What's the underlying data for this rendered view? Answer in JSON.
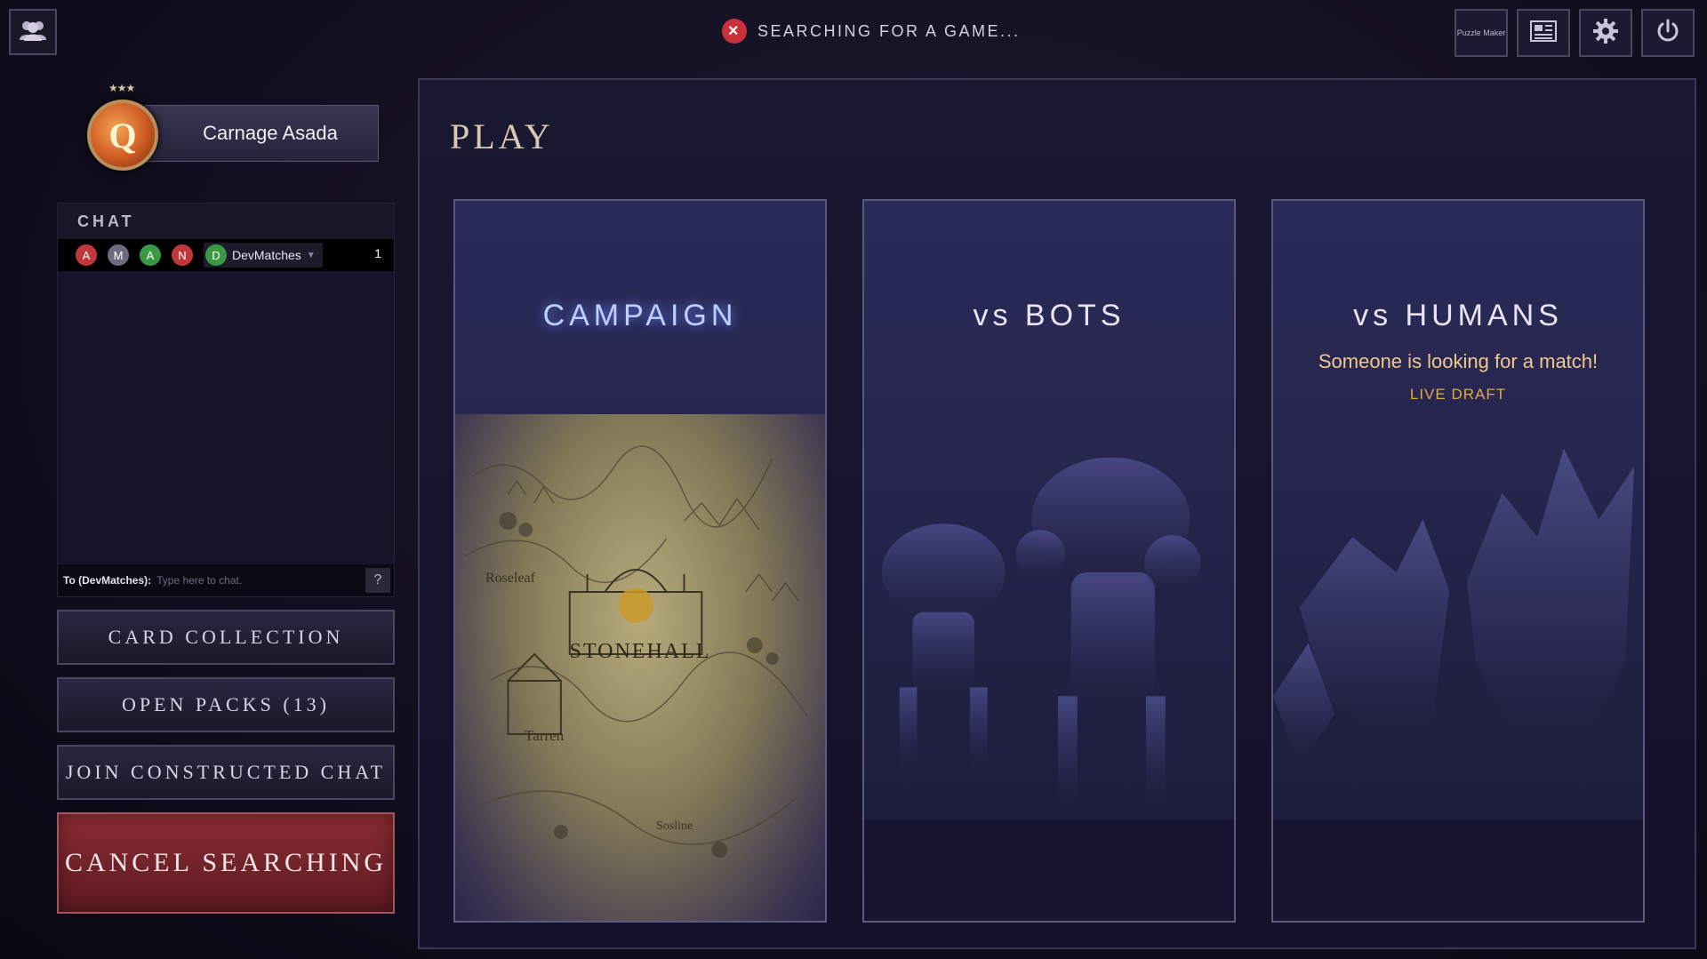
{
  "header": {
    "status_text": "SEARCHING FOR A GAME...",
    "puzzle_maker_label": "Puzzle Maker"
  },
  "player": {
    "name": "Carnage Asada",
    "avatar_letter": "Q",
    "stars": "★★★"
  },
  "chat": {
    "title": "CHAT",
    "channels": [
      {
        "letter": "A",
        "color": "#c0383c"
      },
      {
        "letter": "M",
        "color": "#6e6a80"
      },
      {
        "letter": "A",
        "color": "#3a9a44"
      },
      {
        "letter": "N",
        "color": "#c0383c"
      }
    ],
    "active_channel": {
      "letter": "D",
      "label": "DevMatches",
      "color": "#3a9a44"
    },
    "unread_count": "1",
    "input_to": "To (DevMatches):",
    "input_placeholder": "Type here to chat.",
    "help_label": "?"
  },
  "side_buttons": {
    "card_collection": "CARD COLLECTION",
    "open_packs": "OPEN PACKS (13)",
    "join_chat": "JOIN CONSTRUCTED CHAT",
    "cancel": "CANCEL SEARCHING"
  },
  "play": {
    "title": "PLAY",
    "modes": {
      "campaign": {
        "title": "CAMPAIGN",
        "map_labels": {
          "city": "STONEHALL",
          "west": "Roseleaf",
          "southwest": "Tarren",
          "south": "Sosline"
        }
      },
      "bots": {
        "title": "vs BOTS"
      },
      "humans": {
        "title": "vs HUMANS",
        "subtitle": "Someone is looking for a match!",
        "tag": "LIVE DRAFT"
      }
    }
  },
  "icons": {
    "friends": "friends-icon",
    "cancel_search": "close-icon",
    "news": "news-icon",
    "settings": "gear-icon",
    "power": "power-icon"
  }
}
